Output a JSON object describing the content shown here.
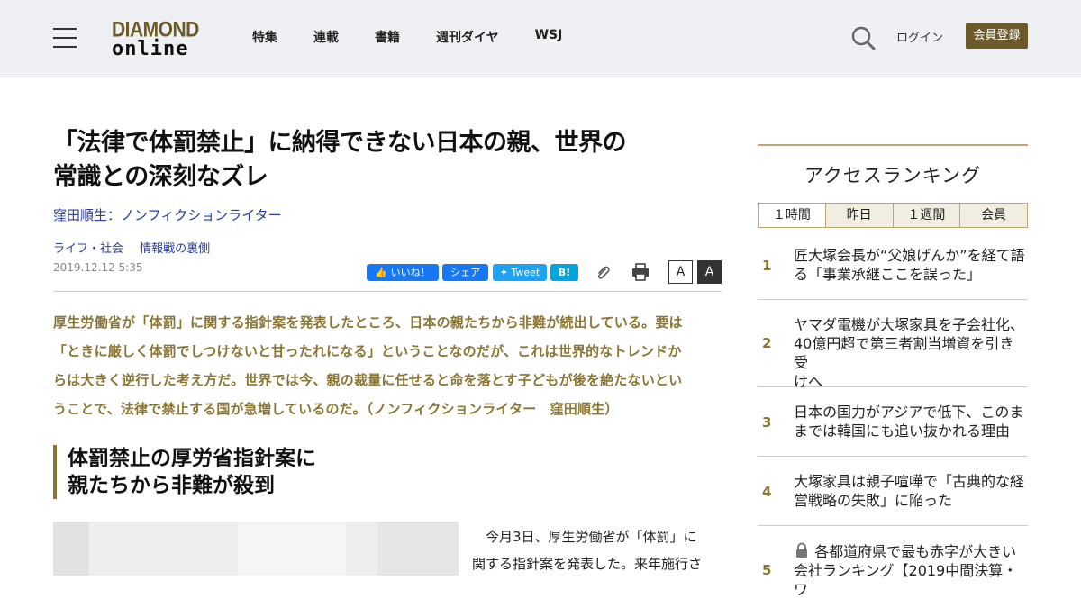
{
  "header": {
    "logo_line1": "DIAMOND",
    "logo_line2": "online",
    "nav": [
      "特集",
      "連載",
      "書籍",
      "週刊ダイヤ",
      "WSJ"
    ],
    "login_label": "ログイン",
    "register_label": "会員登録",
    "icons": [
      "menu-icon",
      "search-icon"
    ]
  },
  "article": {
    "title_line1": "「法律で体罰禁止」に納得できない日本の親、世界の",
    "title_line2": "常識との深刻なズレ",
    "author": "窪田順生：ノンフィクションライター",
    "categories": [
      "ライフ・社会",
      "情報戦の裏側"
    ],
    "date": "2019.12.12 5:35",
    "share": {
      "like_label": "いいね！",
      "share_label": "シェア",
      "tweet_label": "Tweet",
      "hatena_label": "B!",
      "font_small": "A",
      "font_large": "A"
    },
    "lead_lines": [
      "厚生労働省が「体罰」に関する指針案を発表したところ、日本の親たちから非難が続出している。要は",
      "「ときに厳しく体罰でしつけないと甘ったれになる」ということなのだが、これは世界的なトレンドか",
      "らは大きく逆行した考え方だ。世界では今、親の裁量に任せると命を落とす子どもが後を絶たないとい",
      "うことで、法律で禁止する国が急増しているのだ。（ノンフィクションライター　窪田順生）"
    ],
    "subheading_line1": "体罰禁止の厚労省指針案に",
    "subheading_line2": "親たちから非難が殺到",
    "body_line1": "今月3日、厚生労働省が「体罰」に",
    "body_line2": "関する指針案を発表した。来年施行さ"
  },
  "sidebar": {
    "title": "アクセスランキング",
    "tabs": [
      "１時間",
      "昨日",
      "１週間",
      "会員"
    ],
    "active_tab": "１時間",
    "items": [
      {
        "rank": "1",
        "line1": "匠大塚会長が“父娘げんか”を経て語",
        "line2": "る「事業承継ここを誤った」",
        "line3": ""
      },
      {
        "rank": "2",
        "line1": "ヤマダ電機が大塚家具を子会社化、",
        "line2": "40億円超で第三者割当増資を引き受",
        "line3": "けへ"
      },
      {
        "rank": "3",
        "line1": "日本の国力がアジアで低下、このま",
        "line2": "までは韓国にも追い抜かれる理由",
        "line3": ""
      },
      {
        "rank": "4",
        "line1": "大塚家具は親子喧嘩で「古典的な経",
        "line2": "営戦略の失敗」に陥った",
        "line3": ""
      },
      {
        "rank": "5",
        "line1": "各都道府県で最も赤字が大きい",
        "line2": "会社ランキング【2019中間決算・ワ",
        "line3": ""
      }
    ]
  },
  "colors": {
    "accent": "#6b5a2a",
    "lead_text": "#8a7532",
    "link": "#2a3e9a",
    "facebook": "#1877f2",
    "twitter": "#1da1f2",
    "hatena": "#00a4de"
  }
}
